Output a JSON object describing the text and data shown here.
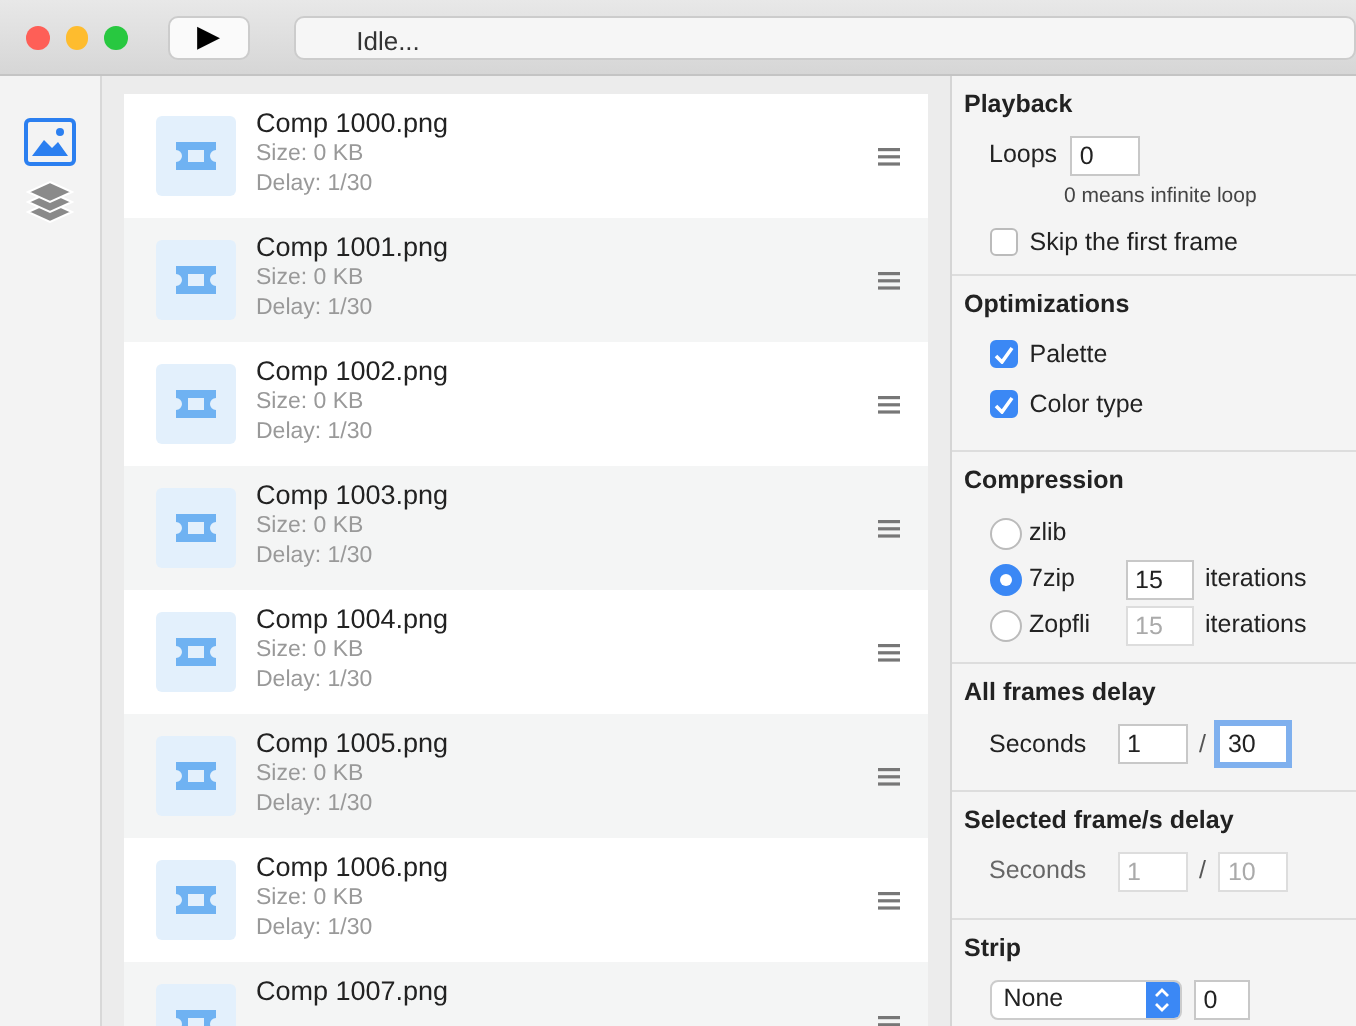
{
  "toolbar": {
    "play": "▶",
    "status": "Idle..."
  },
  "sidebar": {
    "items": [
      {
        "kind": "image",
        "selected": true
      },
      {
        "kind": "layers",
        "selected": false
      }
    ]
  },
  "frames": [
    {
      "name": "Comp 1000.png",
      "size": "Size: 0 KB",
      "delay": "Delay: 1/30"
    },
    {
      "name": "Comp 1001.png",
      "size": "Size: 0 KB",
      "delay": "Delay: 1/30"
    },
    {
      "name": "Comp 1002.png",
      "size": "Size: 0 KB",
      "delay": "Delay: 1/30"
    },
    {
      "name": "Comp 1003.png",
      "size": "Size: 0 KB",
      "delay": "Delay: 1/30"
    },
    {
      "name": "Comp 1004.png",
      "size": "Size: 0 KB",
      "delay": "Delay: 1/30"
    },
    {
      "name": "Comp 1005.png",
      "size": "Size: 0 KB",
      "delay": "Delay: 1/30"
    },
    {
      "name": "Comp 1006.png",
      "size": "Size: 0 KB",
      "delay": "Delay: 1/30"
    },
    {
      "name": "Comp 1007.png"
    }
  ],
  "playback": {
    "title": "Playback",
    "loops_label": "Loops",
    "loops": "0",
    "hint": "0 means infinite loop",
    "skip_first": {
      "label": "Skip the first frame",
      "checked": false
    }
  },
  "optimizations": {
    "title": "Optimizations",
    "options": [
      {
        "label": "Palette",
        "checked": true
      },
      {
        "label": "Color type",
        "checked": true
      }
    ]
  },
  "compression": {
    "title": "Compression",
    "options": [
      {
        "label": "zlib",
        "selected": false
      },
      {
        "label": "7zip",
        "selected": true,
        "iterations": "15",
        "unit": "iterations"
      },
      {
        "label": "Zopfli",
        "selected": false,
        "iterations": "15",
        "unit": "iterations"
      }
    ]
  },
  "delays": [
    {
      "title": "All frames delay",
      "label": "Seconds",
      "separator": "/",
      "disabled": false,
      "fields": [
        {
          "value": "1",
          "focused": false
        },
        {
          "value": "30",
          "focused": true
        }
      ]
    },
    {
      "title": "Selected frame/s delay",
      "label": "Seconds",
      "separator": "/",
      "disabled": true,
      "fields": [
        {
          "value": "1",
          "focused": false
        },
        {
          "value": "10",
          "focused": false
        }
      ]
    }
  ],
  "strip": {
    "title": "Strip",
    "select": "None",
    "value": "0"
  }
}
